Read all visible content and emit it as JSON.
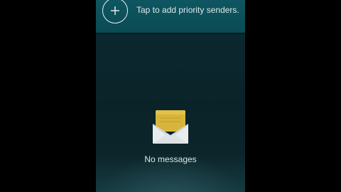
{
  "priority_senders": {
    "prompt": "Tap to add priority senders."
  },
  "empty_state": {
    "message": "No messages"
  },
  "icons": {
    "add": "plus-icon",
    "empty": "envelope-icon"
  },
  "colors": {
    "header_bar": "#0e5661",
    "screen_background": "#0a2329",
    "envelope_letter": "#d8b53a",
    "envelope_body": "#e9ecee"
  }
}
